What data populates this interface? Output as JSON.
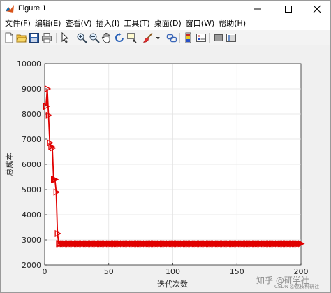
{
  "window": {
    "title": "Figure 1",
    "controls": {
      "minimize": "—",
      "maximize": "☐",
      "close": "✕"
    }
  },
  "menu": {
    "items": [
      "文件(F)",
      "编辑(E)",
      "查看(V)",
      "插入(I)",
      "工具(T)",
      "桌面(D)",
      "窗口(W)",
      "帮助(H)"
    ]
  },
  "toolbar": {
    "icons": [
      "new-figure-icon",
      "open-file-icon",
      "save-icon",
      "print-icon",
      "pointer-icon",
      "zoom-in-icon",
      "zoom-out-icon",
      "pan-icon",
      "rotate-3d-icon",
      "data-cursor-icon",
      "brush-icon",
      "brush-dropdown-icon",
      "link-plot-icon",
      "insert-colorbar-icon",
      "insert-legend-icon",
      "hide-plot-tools-icon",
      "show-plot-tools-icon"
    ]
  },
  "chart_data": {
    "type": "line",
    "title": "",
    "xlabel": "迭代次数",
    "ylabel": "总成本",
    "xlim": [
      0,
      200
    ],
    "ylim": [
      2000,
      10000
    ],
    "xticks": [
      0,
      50,
      100,
      150,
      200
    ],
    "yticks": [
      2000,
      3000,
      4000,
      5000,
      6000,
      7000,
      8000,
      9000,
      10000
    ],
    "grid": true,
    "series": [
      {
        "color": "#e00000",
        "marker": "right-triangle",
        "x": [
          1,
          2,
          3,
          4,
          5,
          6,
          7,
          8,
          9,
          10,
          11,
          15,
          20,
          30,
          40,
          50,
          60,
          70,
          80,
          90,
          100,
          110,
          120,
          130,
          140,
          150,
          160,
          170,
          180,
          190,
          200
        ],
        "y": [
          8300,
          9000,
          7950,
          6850,
          6700,
          6650,
          5400,
          5400,
          4900,
          3250,
          2850,
          2850,
          2850,
          2850,
          2850,
          2850,
          2850,
          2850,
          2850,
          2850,
          2850,
          2850,
          2850,
          2850,
          2850,
          2850,
          2850,
          2850,
          2850,
          2850,
          2850
        ]
      }
    ]
  },
  "watermark": {
    "main": "知乎 @研学社",
    "sub": "CSDN @荔枝科研社"
  }
}
